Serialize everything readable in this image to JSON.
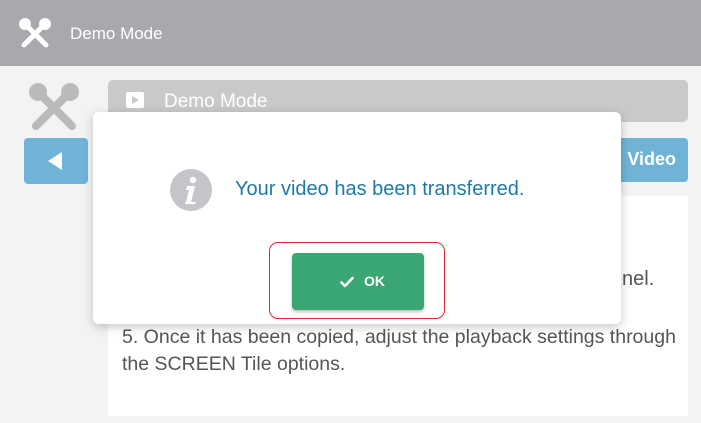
{
  "titlebar": {
    "title": "Demo Mode",
    "icon": "tools-icon"
  },
  "header": {
    "label": "Demo Mode",
    "icon": "video-icon"
  },
  "nav": {
    "back_icon": "back-arrow-icon",
    "video_label": "Video"
  },
  "content": {
    "partial_text": "nel.",
    "step_text": "5. Once it has been copied, adjust the playback settings through the SCREEN Tile options."
  },
  "dialog": {
    "icon": "info-icon",
    "message": "Your video has been transferred.",
    "ok_label": "OK"
  },
  "colors": {
    "titlebar": "#a7a9ac",
    "accent_blue": "#6fb3d6",
    "message_text": "#1f7aa6",
    "ok_green": "#3aa674",
    "highlight_red": "#e0282d"
  }
}
